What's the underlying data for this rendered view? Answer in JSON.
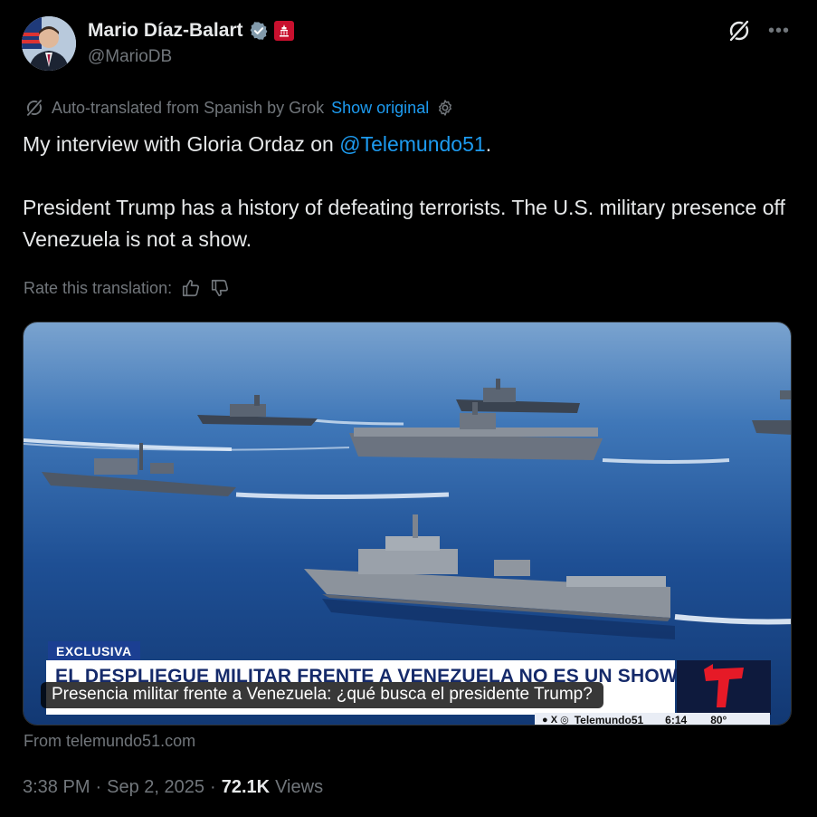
{
  "author": {
    "name": "Mario Díaz-Balart",
    "handle": "@MarioDB"
  },
  "translation_notice": {
    "text": "Auto-translated from Spanish by Grok",
    "show_original_label": "Show original"
  },
  "tweet": {
    "line1_prefix": "My interview with Gloria Ordaz on ",
    "mention": "@Telemundo51",
    "line1_suffix": ".",
    "paragraph2": "President Trump has a history of defeating terrorists. The U.S. military presence off Venezuela is not a show."
  },
  "rate_translation": {
    "label": "Rate this translation:"
  },
  "media": {
    "tag": "EXCLUSIVA",
    "headline": "EL DESPLIEGUE MILITAR FRENTE A VENEZUELA NO ES UN SHOW",
    "caption": "Presencia militar frente a Venezuela: ¿qué busca el presidente Trump?",
    "ticker_handle": "Telemundo51",
    "ticker_time": "6:14",
    "ticker_temp": "80°"
  },
  "source": {
    "text": "From telemundo51.com"
  },
  "meta": {
    "time": "3:38 PM",
    "separator": "·",
    "date": "Sep 2, 2025",
    "views_count": "72.1K",
    "views_label": "Views"
  },
  "colors": {
    "background": "#000000",
    "text": "#e7e9ea",
    "muted": "#71767b",
    "link": "#1d9bf0"
  },
  "icons": {
    "verified": "verified-badge-icon",
    "affiliation": "congress-affiliation-icon",
    "grok": "grok-icon",
    "more": "more-options-icon",
    "settings": "gear-icon",
    "thumbs_up": "thumbs-up-icon",
    "thumbs_down": "thumbs-down-icon"
  }
}
